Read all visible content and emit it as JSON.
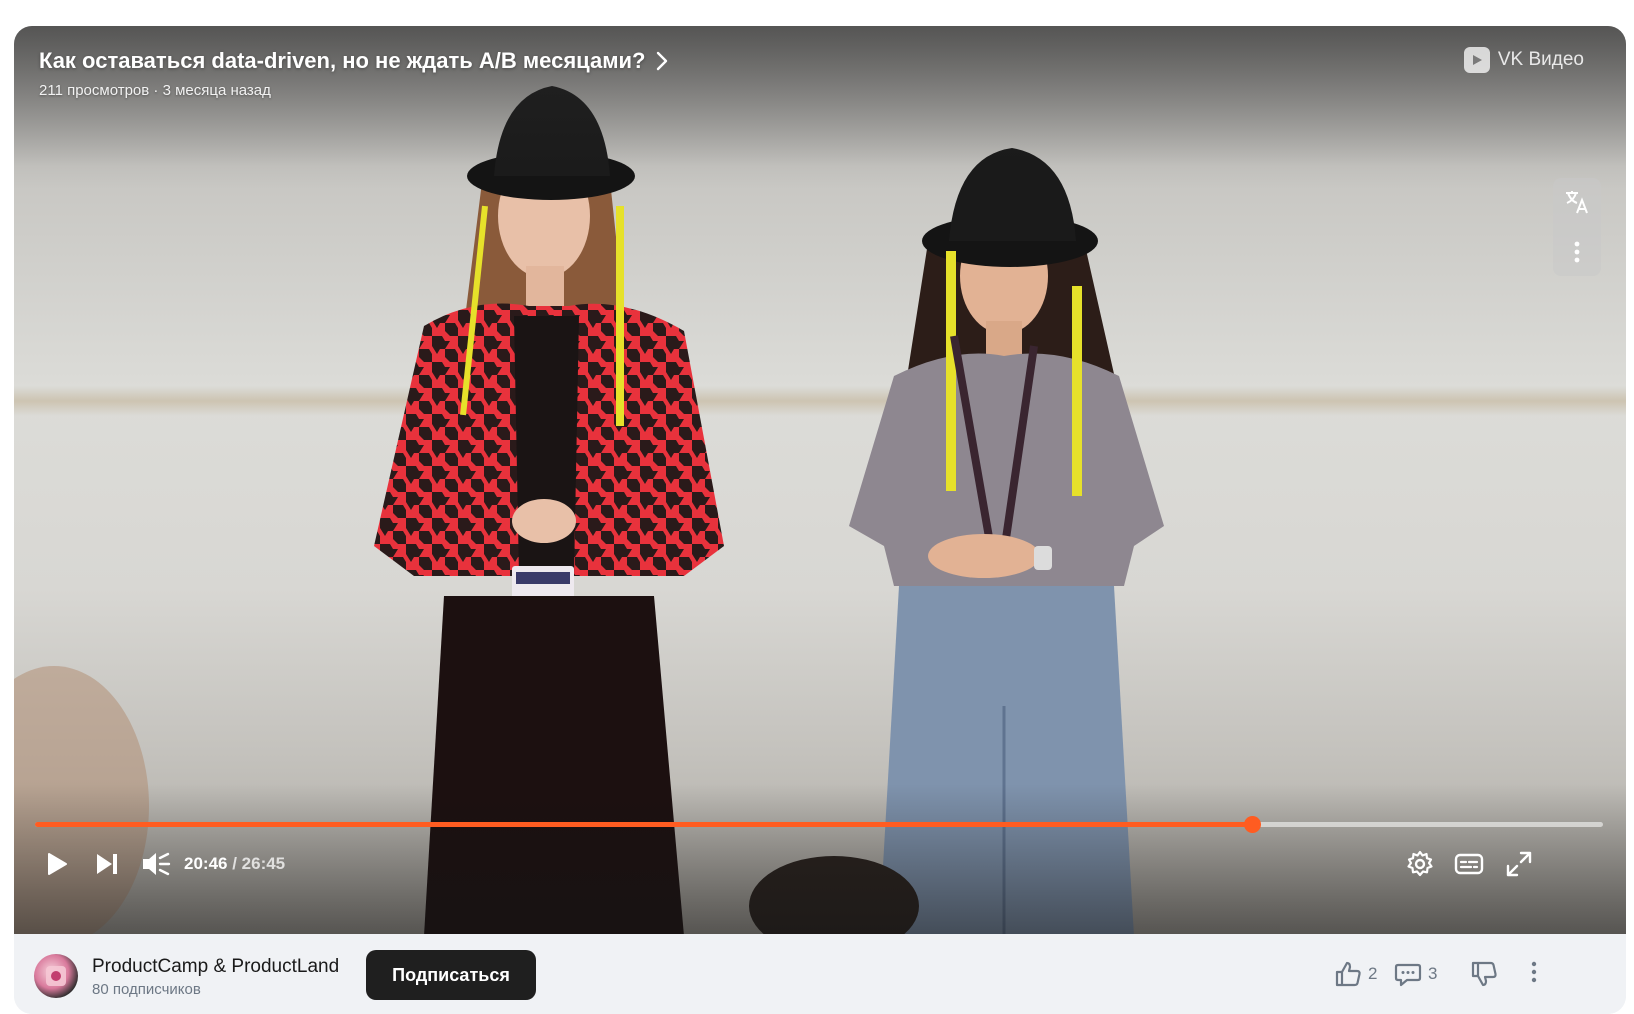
{
  "player": {
    "title": "Как оставаться data-driven, но не ждать A/B месяцами?",
    "meta": "211 просмотров · 3 месяца назад",
    "brand": "VK Видео",
    "time_current": "20:46",
    "time_separator": " / ",
    "time_total": "26:45",
    "progress": 0.7763,
    "icons": {
      "title": "chevron-right-icon",
      "brand": "vk-video-logo-icon",
      "translate": "translate-icon",
      "more": "more-vertical-icon",
      "play": "play-icon",
      "next": "skip-next-icon",
      "volume": "volume-muted-icon",
      "settings": "gear-icon",
      "subtitles": "subtitles-icon",
      "fullscreen": "fullscreen-icon"
    }
  },
  "channel": {
    "name": "ProductCamp & ProductLand",
    "subscribers": "80 подписчиков",
    "subscribe_label": "Подписаться"
  },
  "actions": {
    "likes": "2",
    "comments": "3"
  },
  "colors": {
    "accent": "#ff5c21",
    "button_dark": "#1f1f1f",
    "bar_background": "#f0f2f5",
    "muted_text": "#6d7885"
  }
}
